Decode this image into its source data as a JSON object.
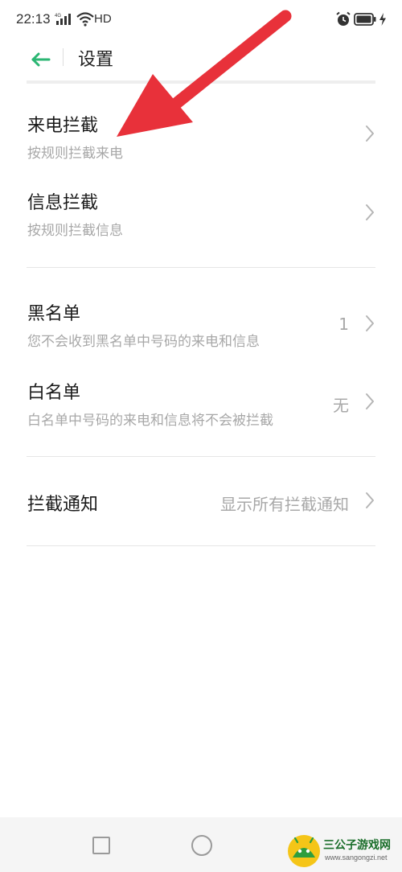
{
  "status_bar": {
    "time": "22:13",
    "network_label": "4G",
    "hd_label": "HD"
  },
  "header": {
    "title": "设置"
  },
  "settings": {
    "call_block": {
      "title": "来电拦截",
      "subtitle": "按规则拦截来电"
    },
    "msg_block": {
      "title": "信息拦截",
      "subtitle": "按规则拦截信息"
    },
    "blacklist": {
      "title": "黑名单",
      "subtitle": "您不会收到黑名单中号码的来电和信息",
      "value": "1"
    },
    "whitelist": {
      "title": "白名单",
      "subtitle": "白名单中号码的来电和信息将不会被拦截",
      "value": "无"
    },
    "block_notify": {
      "title": "拦截通知",
      "value": "显示所有拦截通知"
    }
  },
  "colors": {
    "accent": "#2bb673",
    "annotation_arrow": "#e8313a",
    "secondary_text": "#a8a8a8"
  },
  "icons": {
    "back": "back-arrow-icon",
    "chevron": "chevron-right-icon"
  },
  "watermark": {
    "name": "三公子游戏网",
    "url": "www.sangongzi.net"
  }
}
